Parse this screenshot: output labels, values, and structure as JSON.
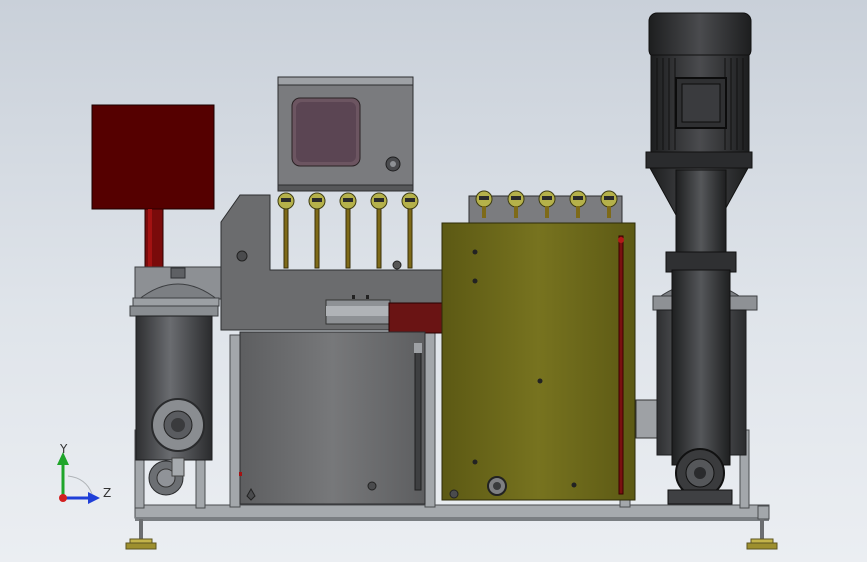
{
  "viewport": {
    "background_top": "#c9d0d9",
    "background_bottom": "#ebeef2"
  },
  "triad": {
    "y_label": "Y",
    "z_label": "Z",
    "y_color": "#1fa52a",
    "z_color": "#1f3fd8",
    "x_color": "#d21f1f"
  },
  "model": {
    "frame_color": "#9a9ea2",
    "tank_color": "#3c3d40",
    "cabinet_color": "#6a6b6d",
    "olive_panel_color": "#6e6a1c",
    "red_box_color": "#550000",
    "accent_red": "#a31212",
    "gauge_count_left": 5,
    "gauge_count_right": 5,
    "motor_color": "#2b2c2e",
    "foot_color": "#c3b44a"
  }
}
